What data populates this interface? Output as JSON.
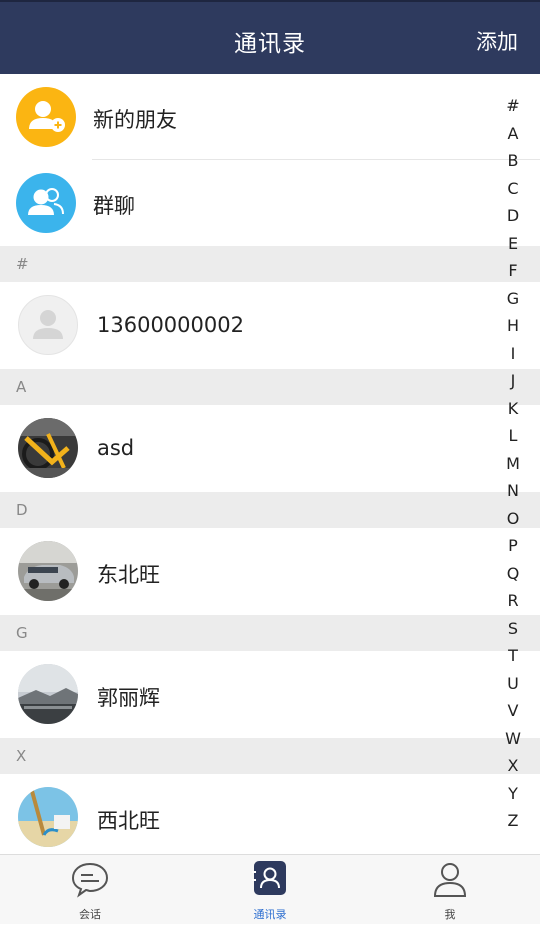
{
  "header": {
    "title": "通讯录",
    "add_label": "添加"
  },
  "fixed_items": [
    {
      "label": "新的朋友",
      "icon": "new-friend-icon",
      "color": "#fbb512"
    },
    {
      "label": "群聊",
      "icon": "group-chat-icon",
      "color": "#3bb4ec"
    }
  ],
  "sections": [
    {
      "letter": "#",
      "contacts": [
        {
          "name": "13600000002",
          "avatar": "default-avatar"
        }
      ]
    },
    {
      "letter": "A",
      "contacts": [
        {
          "name": "asd",
          "avatar": "bicycle-photo"
        }
      ]
    },
    {
      "letter": "D",
      "contacts": [
        {
          "name": "东北旺",
          "avatar": "car-photo"
        }
      ]
    },
    {
      "letter": "G",
      "contacts": [
        {
          "name": "郭丽辉",
          "avatar": "landscape-photo"
        }
      ]
    },
    {
      "letter": "X",
      "contacts": [
        {
          "name": "西北旺",
          "avatar": "beach-photo"
        }
      ]
    }
  ],
  "index_letters": [
    "#",
    "A",
    "B",
    "C",
    "D",
    "E",
    "F",
    "G",
    "H",
    "I",
    "J",
    "K",
    "L",
    "M",
    "N",
    "O",
    "P",
    "Q",
    "R",
    "S",
    "T",
    "U",
    "V",
    "W",
    "X",
    "Y",
    "Z"
  ],
  "tabs": [
    {
      "label": "会话",
      "icon": "chat-bubble-icon",
      "active": false
    },
    {
      "label": "通讯录",
      "icon": "contacts-icon",
      "active": true
    },
    {
      "label": "我",
      "icon": "profile-icon",
      "active": false
    }
  ],
  "colors": {
    "header_bg": "#2e3a5e",
    "active_tab": "#2e6fd0",
    "section_bg": "#ececec"
  }
}
